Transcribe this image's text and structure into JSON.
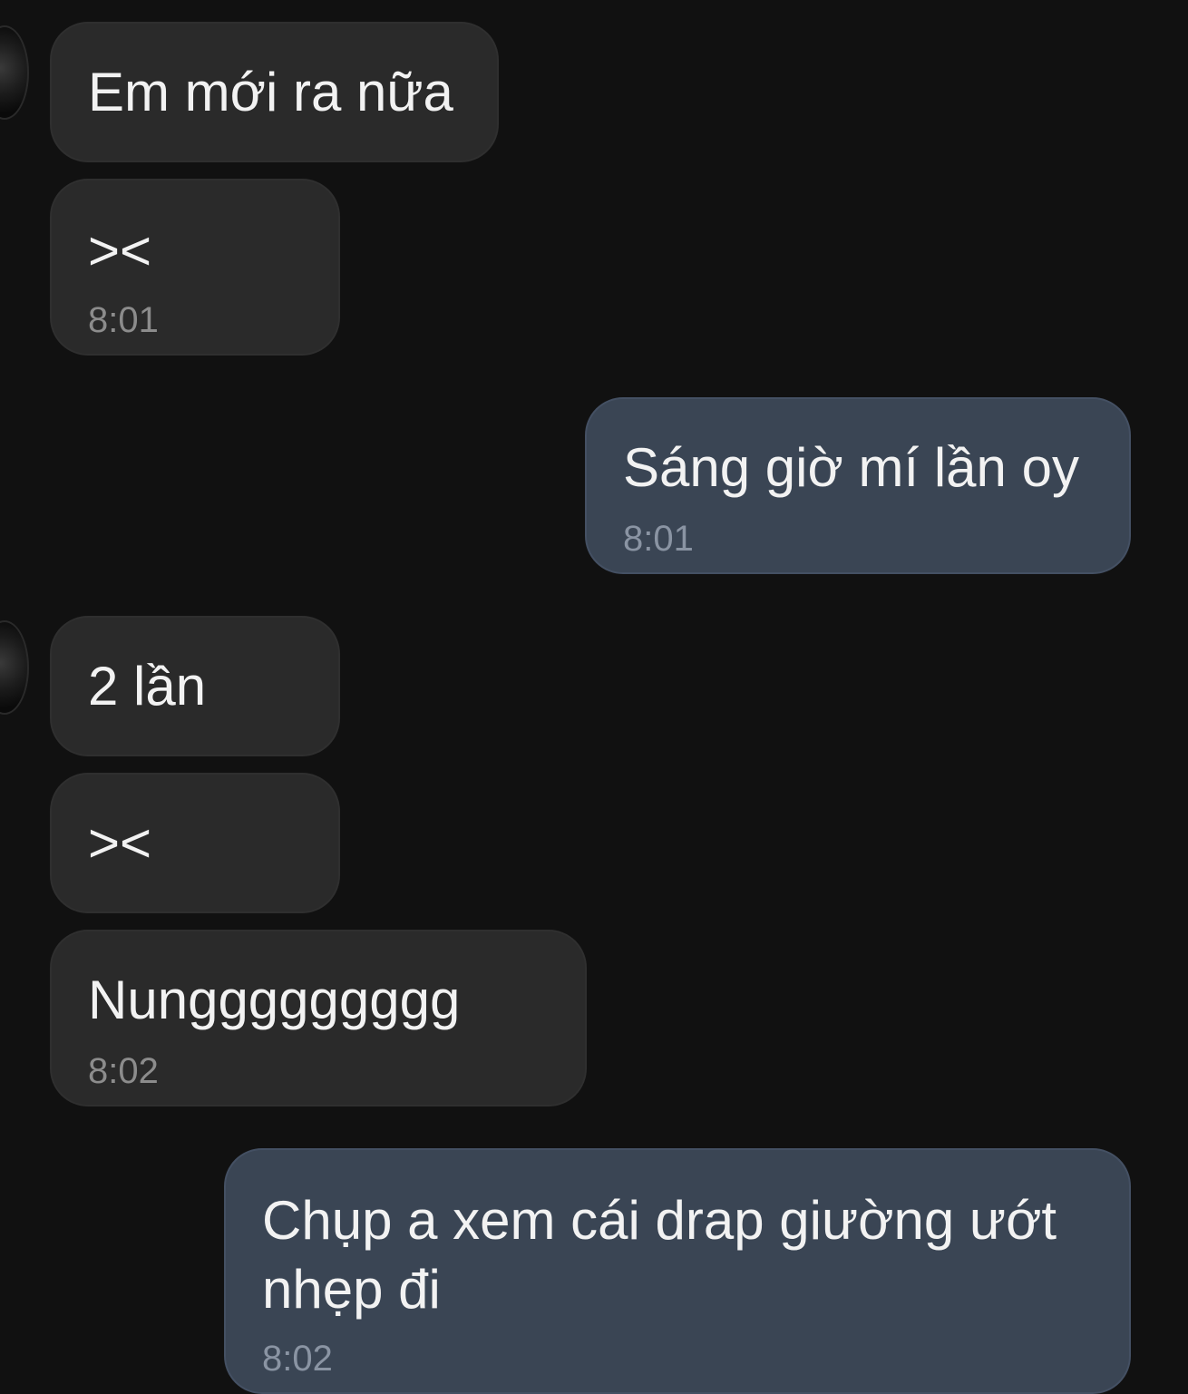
{
  "colors": {
    "background": "#111111",
    "incoming_bubble": "#2a2a2a",
    "outgoing_bubble": "#3a4554",
    "text": "#f2f2f2",
    "time_text": "#8c8c8c"
  },
  "messages": [
    {
      "direction": "incoming",
      "text": "Em mới ra nữa",
      "time": ""
    },
    {
      "direction": "incoming",
      "text": "><",
      "time": "8:01"
    },
    {
      "direction": "outgoing",
      "text": "Sáng giờ mí lần oy",
      "time": "8:01"
    },
    {
      "direction": "incoming",
      "text": "2 lần",
      "time": ""
    },
    {
      "direction": "incoming",
      "text": "><",
      "time": ""
    },
    {
      "direction": "incoming",
      "text": "Nunggggggggg",
      "time": "8:02"
    },
    {
      "direction": "outgoing",
      "text": "Chụp a xem cái drap giường ướt nhẹp đi",
      "time": "8:02"
    }
  ]
}
